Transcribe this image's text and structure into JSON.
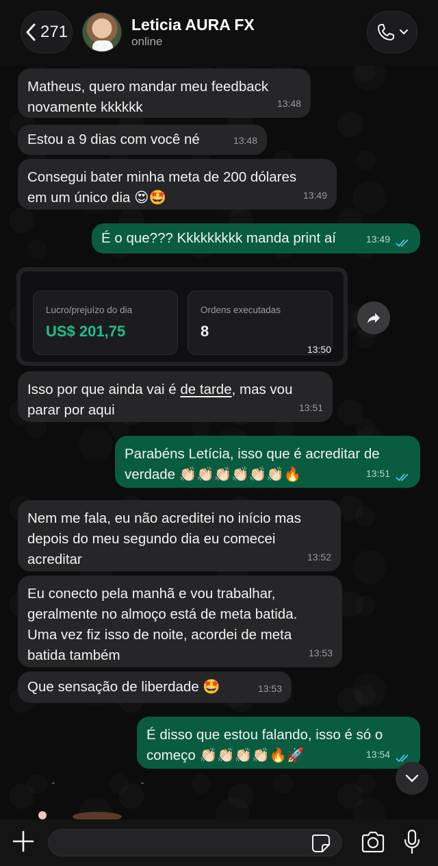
{
  "header": {
    "back_count": "271",
    "contact_name": "Leticia AURA FX",
    "status": "online"
  },
  "messages": [
    {
      "dir": "in",
      "text": "Matheus, quero mandar meu feedback\nnovamente kkkkkk",
      "time": "13:48"
    },
    {
      "dir": "in",
      "text": "Estou a 9 dias com você né",
      "time": "13:48"
    },
    {
      "dir": "in",
      "text": "Consegui bater minha meta de 200 dólares\nem um único dia 😍🤩",
      "time": "13:49"
    },
    {
      "dir": "out",
      "text": "É o que??? Kkkkkkkkk manda print aí",
      "time": "13:49"
    },
    {
      "dir": "in",
      "text_before": "Isso por que ainda vai é ",
      "text_link": "de tarde",
      "text_after": ", mas vou\nparar por aqui",
      "time": "13:51"
    },
    {
      "dir": "out",
      "text": "Parabéns Letícia, isso que é acreditar de\nverdade 👏🏻👏🏻👏🏻👏🏻👏🏻👏🏻🔥",
      "time": "13:51"
    },
    {
      "dir": "in",
      "text": "Nem me fala, eu não acreditei no início mas\ndepois do meu segundo dia eu comecei\nacreditar",
      "time": "13:52"
    },
    {
      "dir": "in",
      "text": "Eu conecto pela manhã e vou trabalhar,\ngeralmente no almoço está de meta batida.\nUma vez fiz isso de noite, acordei de meta\nbatida também",
      "time": "13:53"
    },
    {
      "dir": "in",
      "text": "Que sensação de liberdade 🤩",
      "time": "13:53"
    },
    {
      "dir": "out",
      "text": "É disso que estou falando, isso é só o\ncomeço 👏🏻👏🏻👏🏻👏🏻🔥🚀",
      "time": "13:54"
    }
  ],
  "image_message": {
    "card1_label": "Lucro/prejuízo do dia",
    "card1_value": "US$ 201,75",
    "card2_label": "Ordens executadas",
    "card2_value": "8",
    "time": "13:50"
  },
  "footer": {
    "input_value": ""
  },
  "colors": {
    "incoming_bubble": "#262628",
    "outgoing_bubble": "#0a5c40",
    "read_ticks": "#53bdeb",
    "profit_value": "#1fbf8f"
  }
}
